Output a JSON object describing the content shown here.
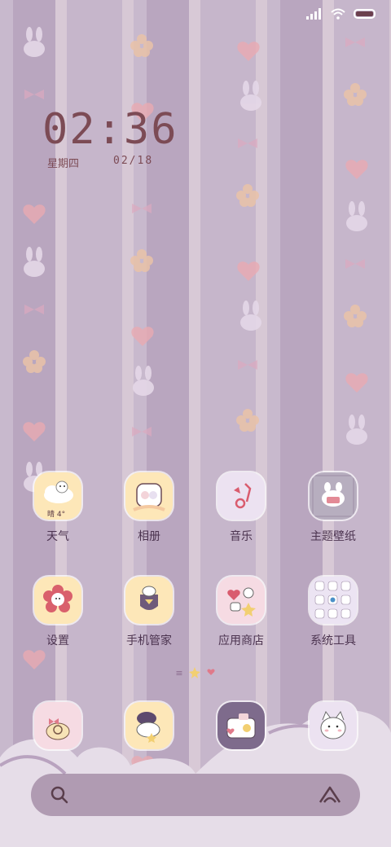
{
  "status_bar": {
    "signal_icon": "signal-bars-icon",
    "wifi_icon": "wifi-icon",
    "battery_icon": "battery-icon"
  },
  "clock": {
    "time": "02:36",
    "weekday": "星期四",
    "date": "02/18"
  },
  "apps_row1": [
    {
      "label": "天气",
      "icon": "weather-cloud-icon",
      "badge": "晴 4°"
    },
    {
      "label": "相册",
      "icon": "gallery-icon"
    },
    {
      "label": "音乐",
      "icon": "music-note-icon"
    },
    {
      "label": "主题壁纸",
      "icon": "theme-wallpaper-icon"
    }
  ],
  "apps_row2": [
    {
      "label": "设置",
      "icon": "gear-flower-icon"
    },
    {
      "label": "手机管家",
      "icon": "phone-manager-icon"
    },
    {
      "label": "应用商店",
      "icon": "app-store-icon"
    },
    {
      "label": "系统工具",
      "icon": "system-tools-folder-icon"
    }
  ],
  "dock": [
    {
      "icon": "phone-icon"
    },
    {
      "icon": "messages-icon"
    },
    {
      "icon": "camera-icon"
    },
    {
      "icon": "browser-cat-icon"
    }
  ],
  "page_indicator": {
    "icons": [
      "menu-lines-icon",
      "star-icon",
      "heart-icon"
    ]
  },
  "search_bar": {
    "search_icon": "search-icon",
    "assistant_icon": "assistant-icon"
  },
  "colors": {
    "clock": "#7c4b55",
    "label": "#4c3450",
    "search_bar": "#9d84a0",
    "heart": "#e07a8a"
  }
}
